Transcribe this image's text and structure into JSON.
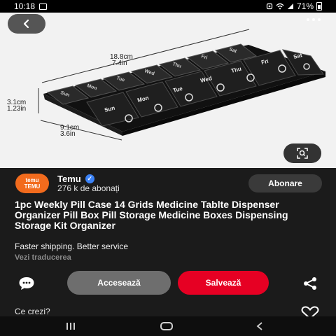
{
  "status_bar": {
    "time": "10:18",
    "battery": "71%",
    "icons": [
      "image-icon",
      "alarm-icon",
      "wifi-icon",
      "signal-icon",
      "battery-icon"
    ]
  },
  "media": {
    "dimensions": {
      "length_cm": "18.8cm",
      "length_in": "7.4in",
      "height_cm": "3.1cm",
      "height_in": "1.23in",
      "width_cm": "9.1cm",
      "width_in": "3.6in"
    },
    "lid_labels_back": [
      "Sun",
      "Mon",
      "Tue",
      "Wed",
      "Thu",
      "Fri",
      "Sat"
    ],
    "lid_labels_front": [
      "Sun",
      "Mon",
      "Tue",
      "Wed",
      "Thu",
      "Fri",
      "Sat"
    ]
  },
  "channel": {
    "avatar_text_top": "temu",
    "avatar_text_bottom": "TEMU",
    "name": "Temu",
    "verified_glyph": "✓",
    "subscribers": "276 k de abonați",
    "subscribe_label": "Abonare"
  },
  "pin": {
    "title": "1pc Weekly Pill Case 14 Grids Medicine Tablte Dispenser Organizer Pill Box Pill Storage Medicine Boxes Dispensing Storage Kit Organizer",
    "description": "Faster shipping. Better service",
    "translate_label": "Vezi traducerea"
  },
  "actions": {
    "access_label": "Accesează",
    "save_label": "Salvează"
  },
  "comments": {
    "prompt": "Ce crezi?"
  },
  "colors": {
    "save_red": "#e60023",
    "temu_orange": "#f26b1d",
    "verified_blue": "#3b82f6"
  }
}
